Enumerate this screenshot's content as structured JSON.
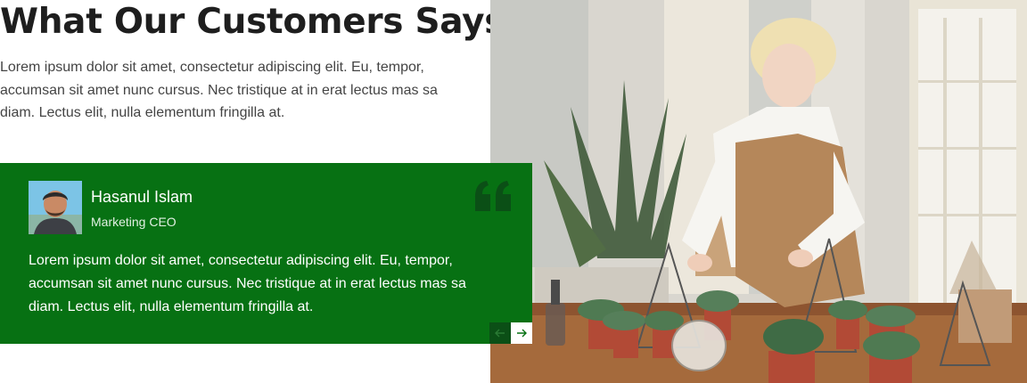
{
  "section": {
    "title": "What Our Customers Says",
    "intro": "Lorem ipsum dolor sit amet, consectetur adipiscing elit. Eu, tempor, accumsan sit amet nunc cursus. Nec tristique at in erat lectus mas sa diam. Lectus elit, nulla elementum fringilla at."
  },
  "testimonial": {
    "name": "Hasanul Islam",
    "role": "Marketing CEO",
    "text": "Lorem ipsum dolor sit amet, consectetur adipiscing elit. Eu, tempor, accumsan sit amet nunc cursus. Nec tristique at in erat lectus mas sa diam. Lectus elit, nulla elementum fringilla at."
  },
  "icons": {
    "quote": "quote-icon",
    "prev": "arrow-left-icon",
    "next": "arrow-right-icon"
  },
  "colors": {
    "card_background": "#077113",
    "quote_mark": "#0b4f16",
    "heading": "#1e1e1e",
    "body_text": "#444444"
  }
}
